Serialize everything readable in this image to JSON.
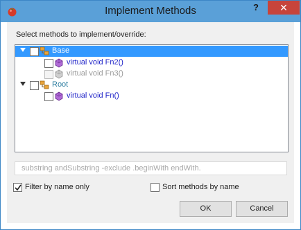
{
  "window": {
    "title": "Implement Methods",
    "help_label": "?",
    "close_label": "✕"
  },
  "section_label": "Select methods to implement/override:",
  "tree": {
    "nodes": [
      {
        "kind": "class",
        "label": "Base",
        "expanded": true,
        "selected": true,
        "checked": false
      },
      {
        "kind": "method",
        "label": "virtual void Fn2()",
        "checked": false,
        "enabled": true
      },
      {
        "kind": "method",
        "label": "virtual void Fn3()",
        "checked": false,
        "enabled": false
      },
      {
        "kind": "class",
        "label": "Root",
        "expanded": true,
        "selected": false,
        "checked": false
      },
      {
        "kind": "method",
        "label": "virtual void Fn()",
        "checked": false,
        "enabled": true
      }
    ]
  },
  "filter": {
    "placeholder": "substring andSubstring -exclude .beginWith endWith.",
    "value": ""
  },
  "options": {
    "filter_by_name_label": "Filter by name only",
    "filter_by_name_checked": true,
    "sort_methods_label": "Sort methods by name",
    "sort_methods_checked": false
  },
  "buttons": {
    "ok_label": "OK",
    "cancel_label": "Cancel"
  },
  "colors": {
    "titlebar": "#5aa0d8",
    "selection": "#3399ff",
    "close": "#c7443b",
    "method_text": "#1f23c8",
    "class_text": "#2b7c9f"
  }
}
